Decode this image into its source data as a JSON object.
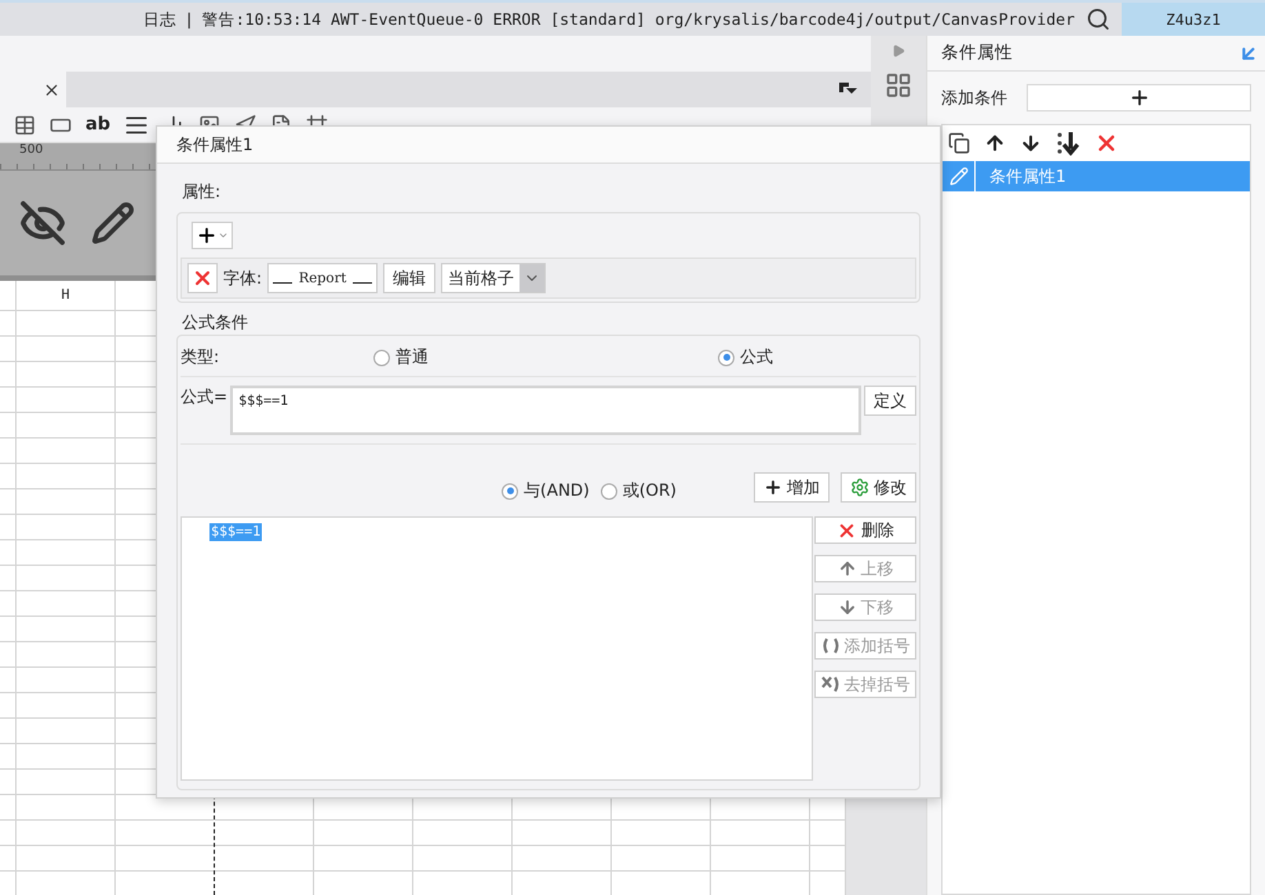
{
  "status_bar": {
    "log_label": "日志",
    "separator": "|",
    "message": "警告:10:53:14 AWT-EventQueue-0 ERROR [standard] org/krysalis/barcode4j/output/CanvasProvider",
    "user": "Z4u3z1"
  },
  "toolbar": {
    "text_tool": "ab"
  },
  "ruler": {
    "mark": "500"
  },
  "sheet": {
    "column_header": "H"
  },
  "dialog": {
    "title": "条件属性1",
    "properties": {
      "legend": "属性:",
      "items": [
        {
          "kind": "font",
          "label": "字体:",
          "preview": "Report",
          "edit_button": "编辑",
          "scope": "当前格子"
        }
      ]
    },
    "formula_condition": {
      "legend": "公式条件",
      "type_label": "类型:",
      "types": [
        {
          "label": "普通",
          "selected": false
        },
        {
          "label": "公式",
          "selected": true
        }
      ],
      "formula_label": "公式=",
      "formula_value": "$$$==1",
      "define_button": "定义",
      "logic": [
        {
          "label": "与(AND)",
          "selected": true
        },
        {
          "label": "或(OR)",
          "selected": false
        }
      ],
      "add_button": "增加",
      "modify_button": "修改",
      "conditions": [
        {
          "text": "$$$==1",
          "selected": true
        }
      ],
      "actions": [
        {
          "kind": "delete",
          "label": "删除",
          "disabled": false
        },
        {
          "kind": "up",
          "label": "上移",
          "disabled": true
        },
        {
          "kind": "down",
          "label": "下移",
          "disabled": true
        },
        {
          "kind": "add_brackets",
          "label": "添加括号",
          "disabled": true
        },
        {
          "kind": "remove_brackets",
          "label": "去掉括号",
          "disabled": true
        }
      ]
    }
  },
  "side_panel": {
    "title": "条件属性",
    "add_label": "添加条件",
    "items": [
      {
        "label": "条件属性1",
        "selected": true
      }
    ]
  }
}
